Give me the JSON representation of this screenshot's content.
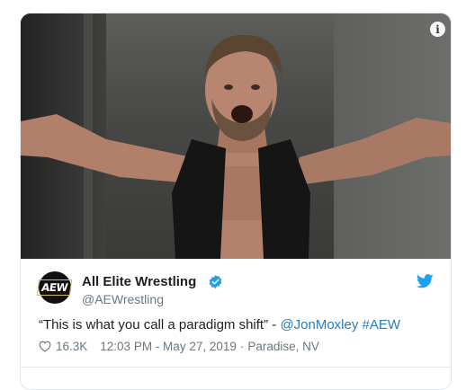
{
  "tweet": {
    "author": {
      "display_name": "All Elite Wrestling",
      "handle": "@AEWrestling",
      "avatar_text": "AEW",
      "verified": true
    },
    "text_prefix": "“This is what you call a paradigm shift” - ",
    "mention": "@JonMoxley",
    "text_space": " ",
    "hashtag": "#AEW",
    "likes": "16.3K",
    "timestamp": "12:03 PM - May 27, 2019",
    "separator": "·",
    "location": "Paradise, NV",
    "footer_partial": ""
  },
  "icons": {
    "info": "info-icon",
    "verified": "verified-badge-icon",
    "bird": "twitter-bird-icon",
    "heart": "heart-icon"
  },
  "colors": {
    "link": "#2b7bb9",
    "verified": "#1da1f2",
    "secondary_text": "#697882",
    "border": "#e1e8ed"
  }
}
